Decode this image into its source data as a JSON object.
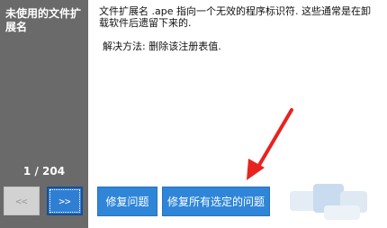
{
  "sidebar": {
    "title": "未使用的文件扩展名",
    "counter": "1 / 204",
    "prev_label": "<<",
    "next_label": ">>"
  },
  "content": {
    "description": "文件扩展名 .ape 指向一个无效的程序标识符. 这些通常是在卸载软件后遗留下来的.",
    "solution": "解决方法: 删除该注册表值."
  },
  "buttons": {
    "fix_label": "修复问题",
    "fix_all_label": "修复所有选定的问题"
  },
  "colors": {
    "sidebar_bg": "#6a6a6a",
    "button_blue": "#2f86d8",
    "annotation_arrow": "#e8231f"
  },
  "icons": {
    "annotation": "red-arrow-icon"
  }
}
